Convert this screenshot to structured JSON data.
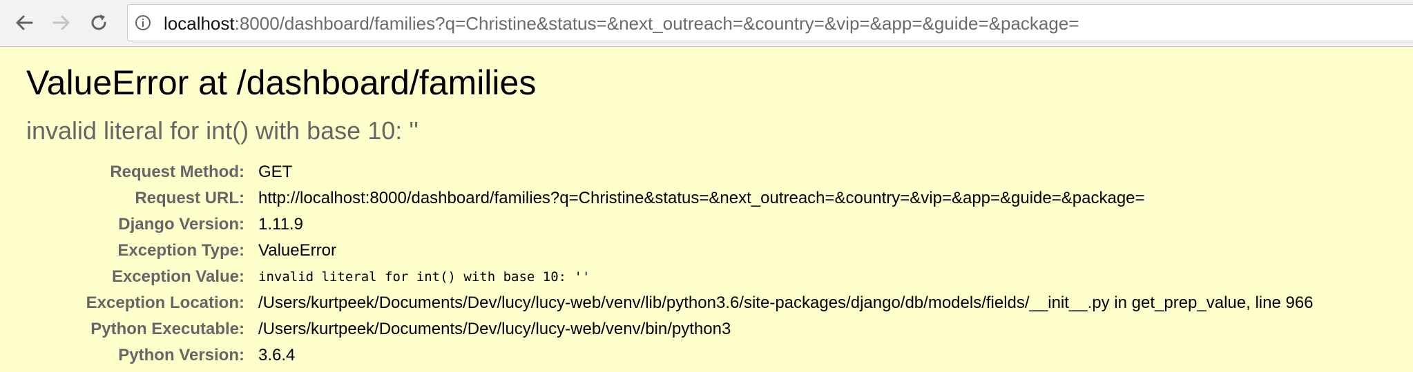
{
  "browser": {
    "url_host": "localhost",
    "url_rest": ":8000/dashboard/families?q=Christine&status=&next_outreach=&country=&vip=&app=&guide=&package="
  },
  "error": {
    "title": "ValueError at /dashboard/families",
    "exception_value_title": "invalid literal for int() with base 10: ''"
  },
  "meta": [
    {
      "label": "Request Method:",
      "value": "GET"
    },
    {
      "label": "Request URL:",
      "value": "http://localhost:8000/dashboard/families?q=Christine&status=&next_outreach=&country=&vip=&app=&guide=&package="
    },
    {
      "label": "Django Version:",
      "value": "1.11.9"
    },
    {
      "label": "Exception Type:",
      "value": "ValueError"
    },
    {
      "label": "Exception Value:",
      "value": "invalid literal for int() with base 10: ''"
    },
    {
      "label": "Exception Location:",
      "value": "/Users/kurtpeek/Documents/Dev/lucy/lucy-web/venv/lib/python3.6/site-packages/django/db/models/fields/__init__.py in get_prep_value, line 966"
    },
    {
      "label": "Python Executable:",
      "value": "/Users/kurtpeek/Documents/Dev/lucy/lucy-web/venv/bin/python3"
    },
    {
      "label": "Python Version:",
      "value": "3.6.4"
    }
  ],
  "colors": {
    "page_background": "#ffffcc",
    "label_gray": "#666666",
    "toolbar": "#f2f2f2"
  },
  "icons": [
    "back-arrow-icon",
    "forward-arrow-icon",
    "reload-icon",
    "info-icon"
  ]
}
